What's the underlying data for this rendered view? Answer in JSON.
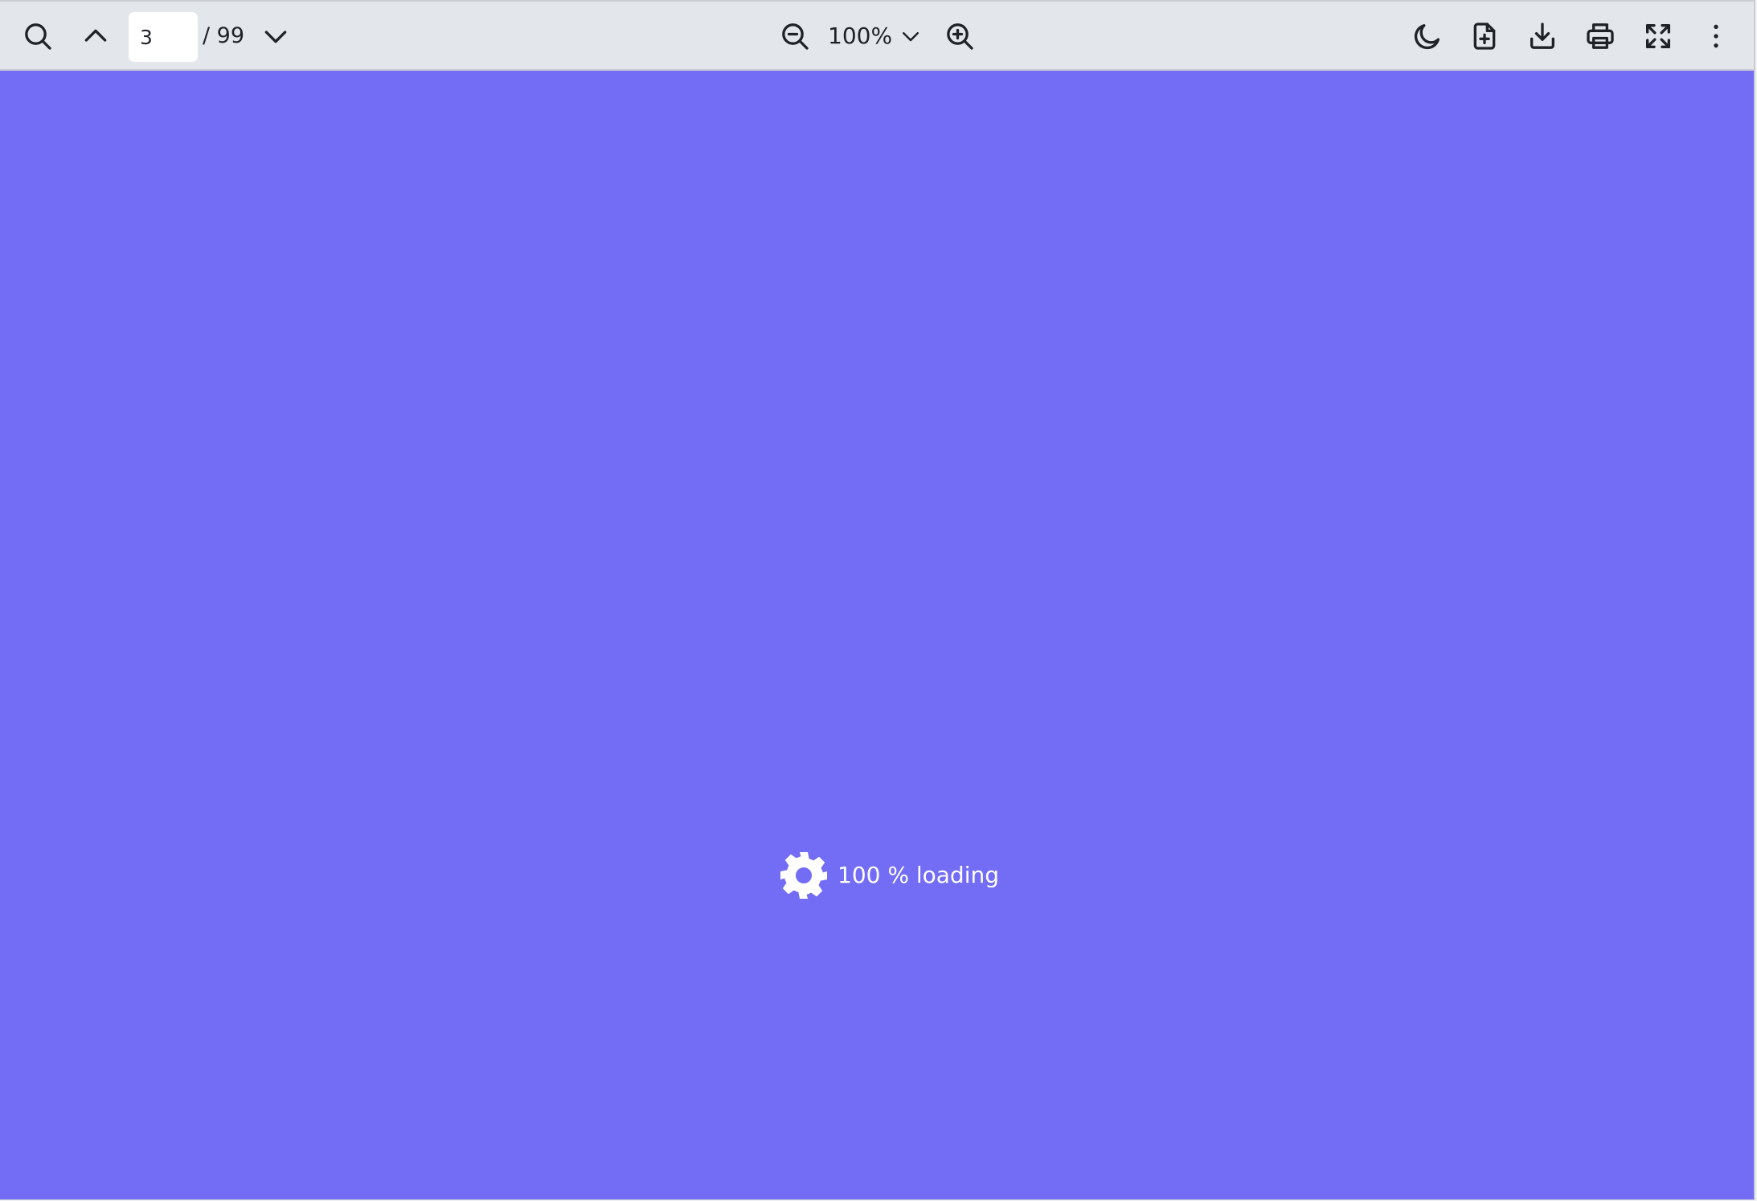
{
  "toolbar": {
    "page_number": "3",
    "page_total": "/ 99",
    "zoom": "100%",
    "icons": {
      "search": "search-icon",
      "prev_page": "chevron-up-icon",
      "next_page": "chevron-down-icon",
      "zoom_out": "zoom-out-icon",
      "zoom_dropdown": "chevron-down-icon",
      "zoom_in": "zoom-in-icon",
      "theme": "moon-icon",
      "open_file": "file-plus-icon",
      "download": "download-icon",
      "print": "printer-icon",
      "fullscreen": "fullscreen-icon",
      "more": "more-vertical-icon"
    }
  },
  "viewer": {
    "background_color": "#736cf5",
    "loading_text": "100 % loading",
    "loading_icon": "gear-icon"
  }
}
